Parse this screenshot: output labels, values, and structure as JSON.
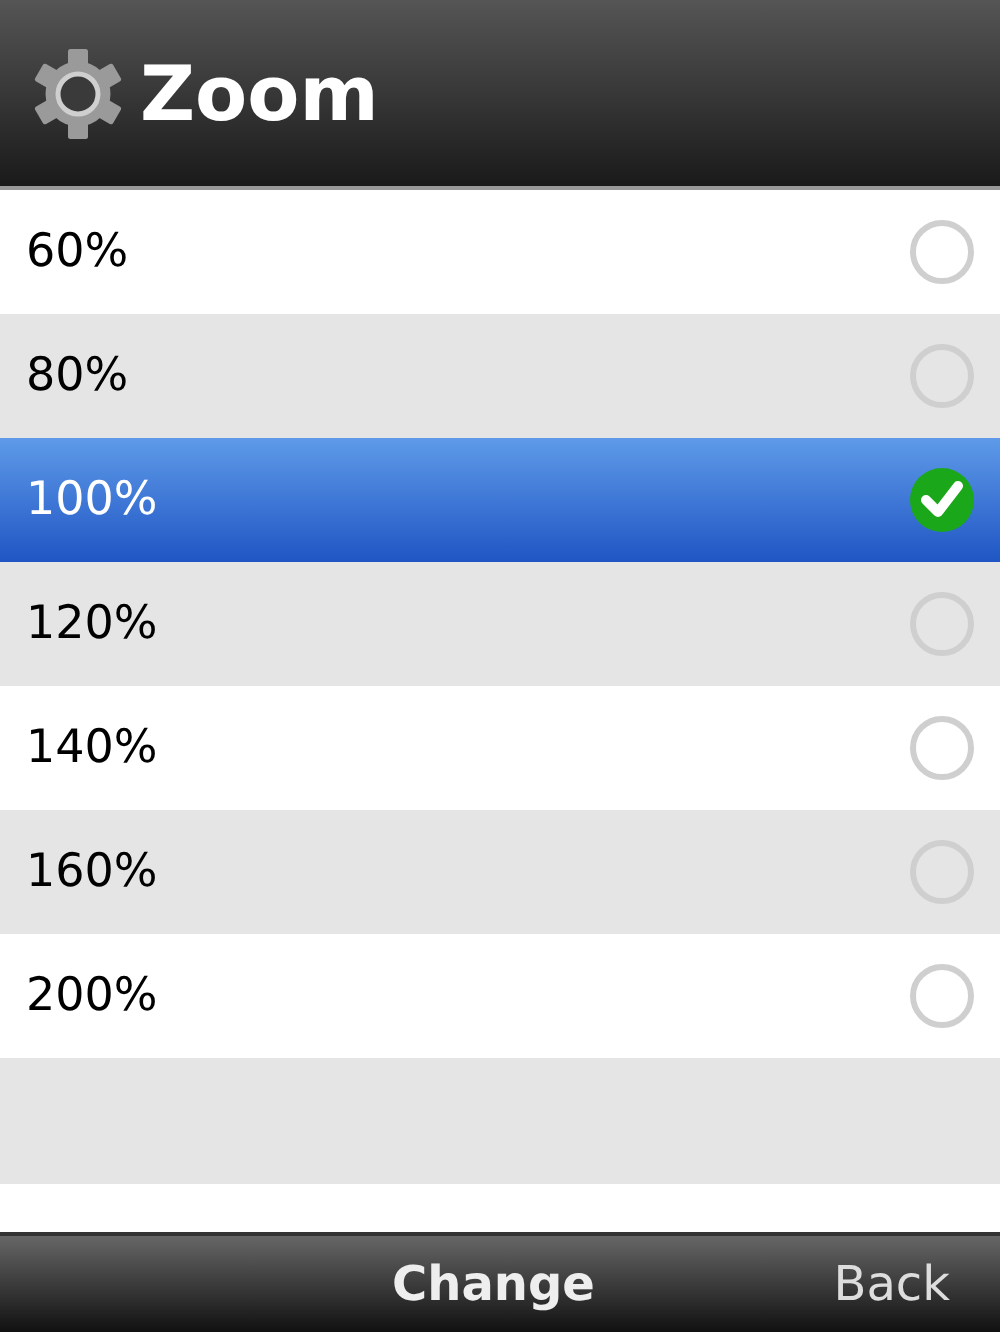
{
  "window": {
    "title": "Zoom"
  },
  "options": [
    {
      "label": "60%",
      "selected": false
    },
    {
      "label": "80%",
      "selected": false
    },
    {
      "label": "100%",
      "selected": true
    },
    {
      "label": "120%",
      "selected": false
    },
    {
      "label": "140%",
      "selected": false
    },
    {
      "label": "160%",
      "selected": false
    },
    {
      "label": "200%",
      "selected": false
    }
  ],
  "softkeys": {
    "center": "Change",
    "right": "Back"
  }
}
